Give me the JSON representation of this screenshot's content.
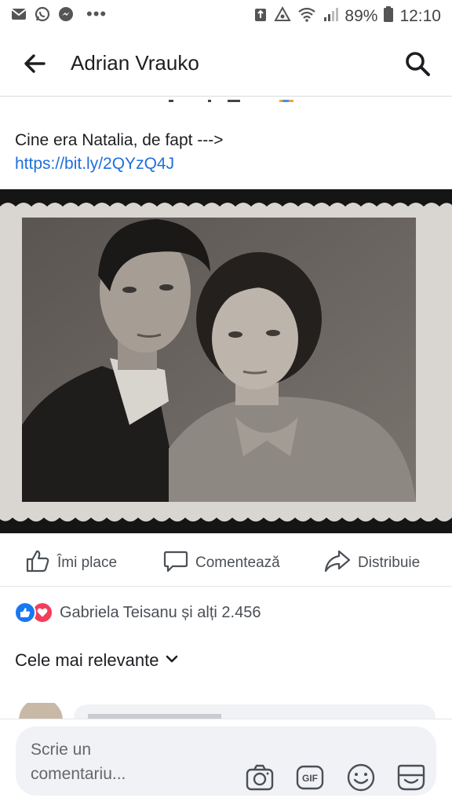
{
  "status_bar": {
    "battery": "89%",
    "time": "12:10",
    "icons": [
      "mail-icon",
      "whatsapp-icon",
      "messenger-icon",
      "more-dots-icon",
      "recycle-icon",
      "sync-icon",
      "wifi-icon",
      "signal-icon",
      "battery-icon"
    ]
  },
  "header": {
    "title": "Adrian Vrauko",
    "icons": [
      "back-arrow-icon",
      "search-icon"
    ]
  },
  "post": {
    "text": "Cine era Natalia, de fapt --->",
    "link": "https://bit.ly/2QYzQ4J"
  },
  "actions": {
    "like": "Îmi place",
    "comment": "Comentează",
    "share": "Distribuie"
  },
  "reactions": {
    "text": "Gabriela Teisanu și alți 2.456",
    "icons": [
      "like-reaction-icon",
      "love-reaction-icon"
    ]
  },
  "comments": {
    "sort_label": "Cele mai relevante"
  },
  "composer": {
    "placeholder": "Scrie un comentariu...",
    "icons": [
      "camera-icon",
      "gif-icon",
      "emoji-icon",
      "sticker-icon"
    ]
  },
  "colors": {
    "link": "#216fdb",
    "like": "#1877f2",
    "love": "#f33e58"
  }
}
